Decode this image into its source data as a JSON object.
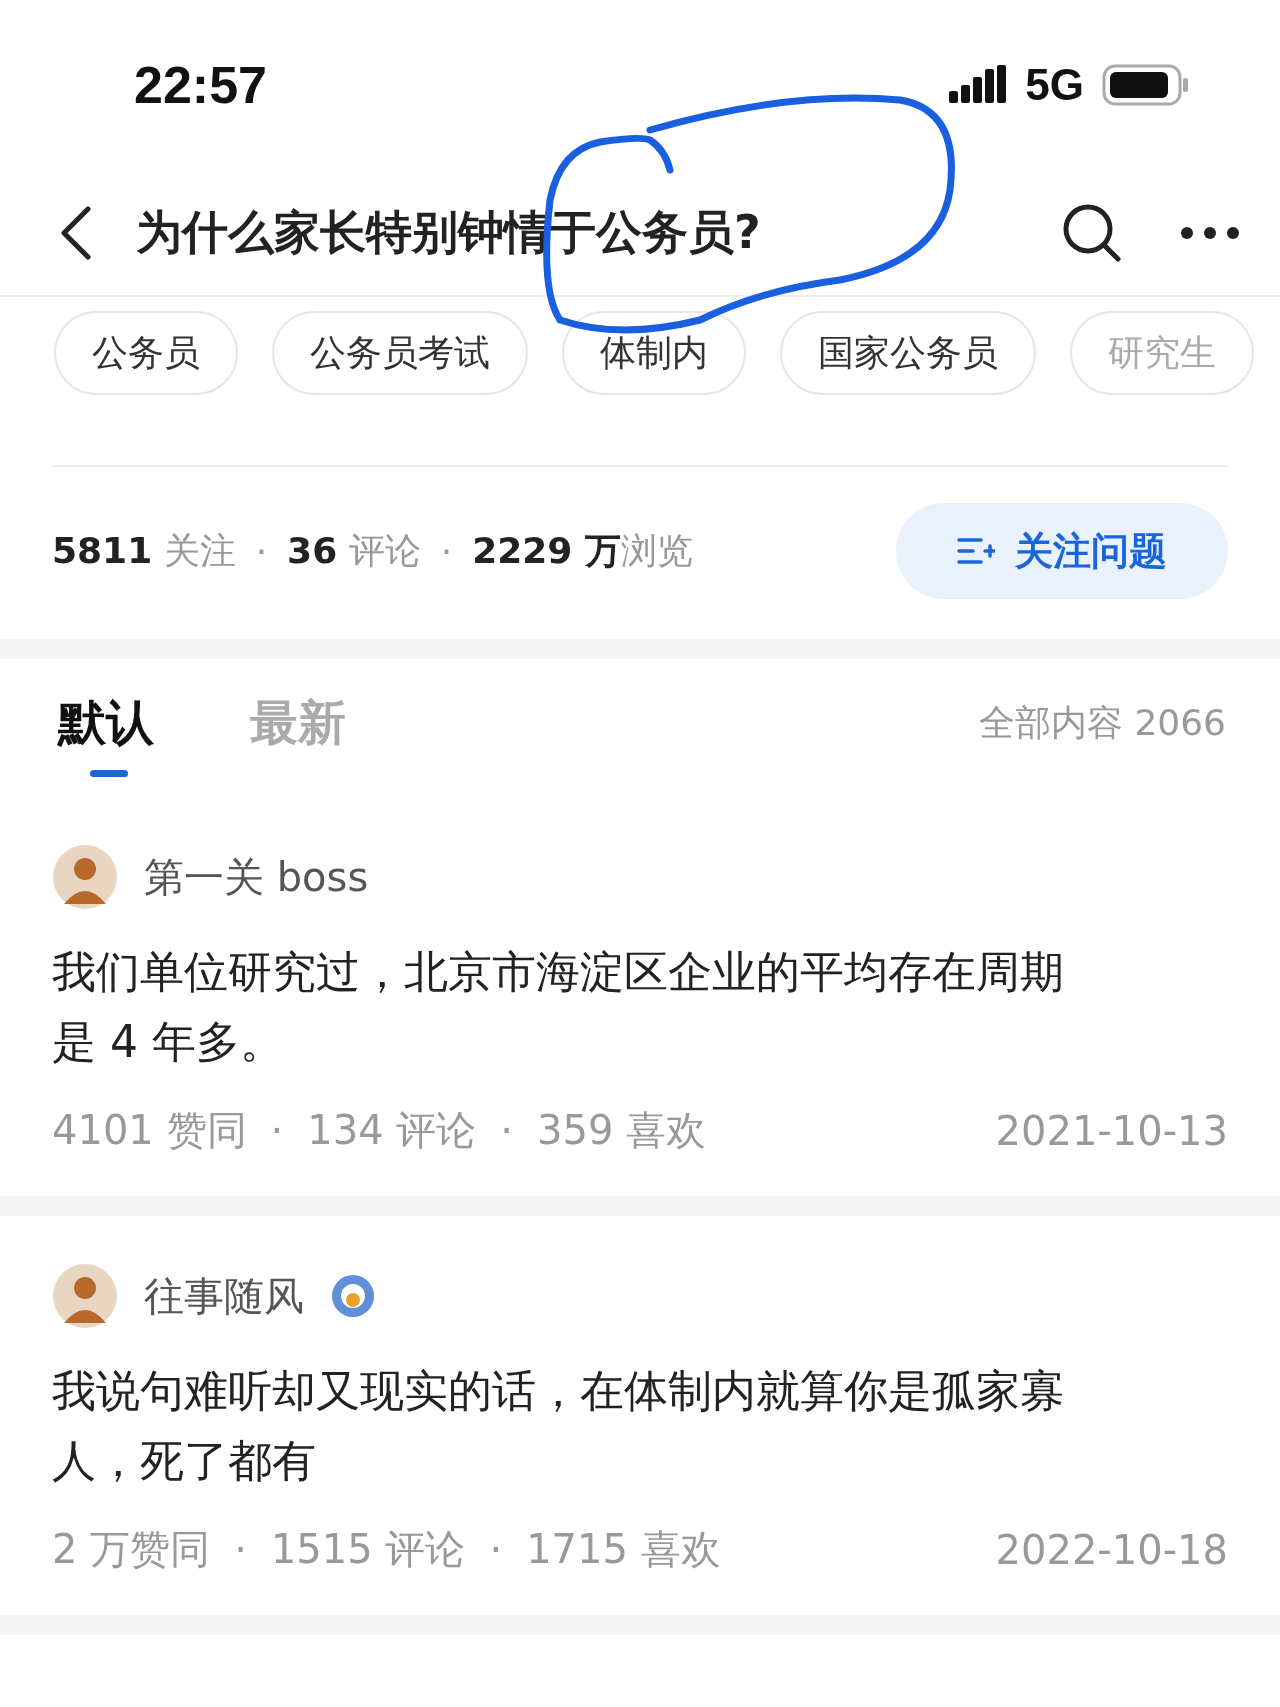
{
  "status_bar": {
    "time": "22:57",
    "network": "5G"
  },
  "header": {
    "title": "为什么家长特别钟情于公务员?"
  },
  "tags": [
    {
      "label": "公务员",
      "faded": false
    },
    {
      "label": "公务员考试",
      "faded": false
    },
    {
      "label": "体制内",
      "faded": false
    },
    {
      "label": "国家公务员",
      "faded": false
    },
    {
      "label": "研究生",
      "faded": true
    }
  ],
  "stats": [
    "**5811** 关注",
    "**36** 评论",
    "**2229 万**浏览"
  ],
  "follow_button": {
    "label": "关注问题"
  },
  "tabs": [
    {
      "label": "默认",
      "selected": true
    },
    {
      "label": "最新",
      "selected": false
    }
  ],
  "content_count": "全部内容 2066",
  "separator": "·",
  "answers": [
    {
      "author": "第一关 boss",
      "badge": false,
      "text": "我们单位研究过，北京市海淀区企业的平均存在周期是 4 年多。",
      "likes": "4101 赞同",
      "comments": "134 评论",
      "favorites": "359 喜欢",
      "date": "2021-10-13"
    },
    {
      "author": "往事随风",
      "badge": true,
      "text": "我说句难听却又现实的话，在体制内就算你是孤家寡人，死了都有",
      "likes": "2 万赞同",
      "comments": "1515 评论",
      "favorites": "1715 喜欢",
      "date": "2022-10-18"
    }
  ]
}
